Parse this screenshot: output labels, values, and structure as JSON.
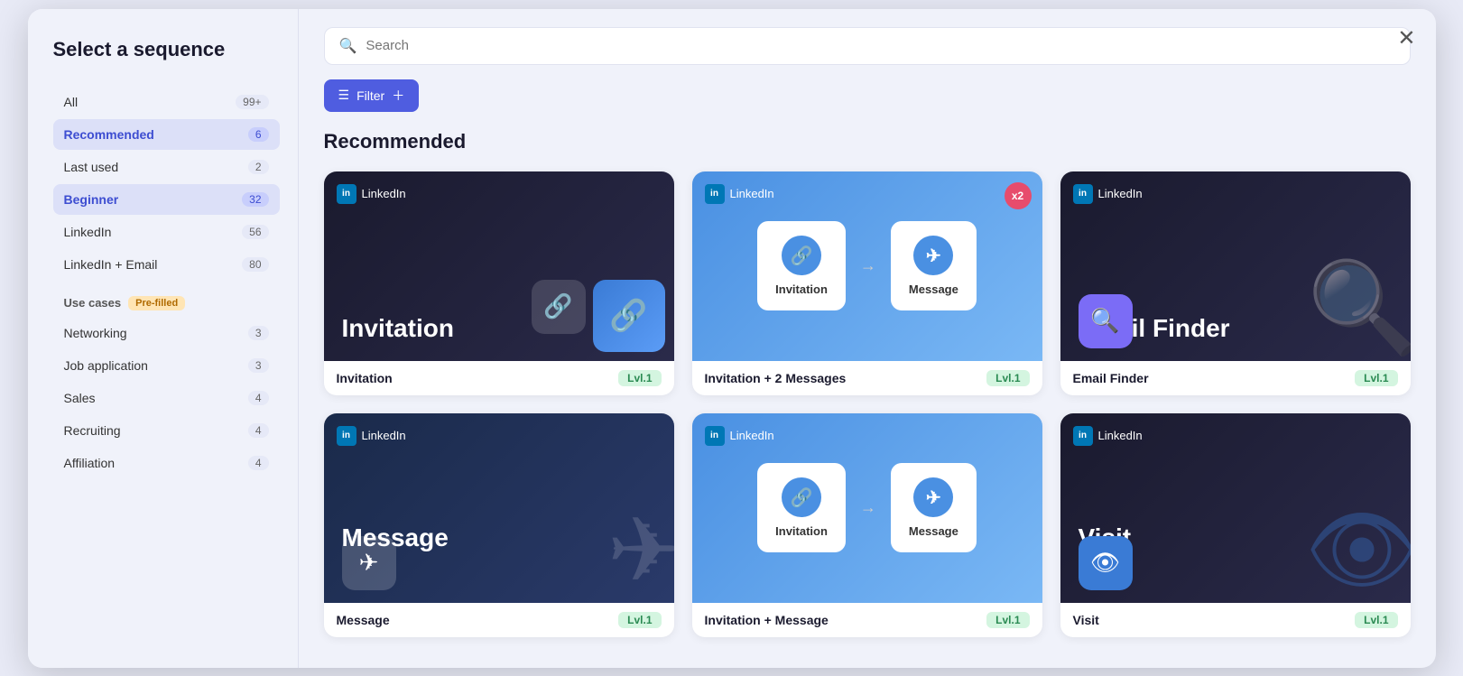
{
  "modal": {
    "title": "Select a sequence",
    "close_label": "✕"
  },
  "sidebar": {
    "title": "Select a sequence",
    "items": [
      {
        "id": "all",
        "label": "All",
        "count": "99+",
        "active": false
      },
      {
        "id": "recommended",
        "label": "Recommended",
        "count": "6",
        "active": true
      },
      {
        "id": "last-used",
        "label": "Last used",
        "count": "2",
        "active": false
      },
      {
        "id": "beginner",
        "label": "Beginner",
        "count": "32",
        "active": false
      },
      {
        "id": "linkedin",
        "label": "LinkedIn",
        "count": "56",
        "active": false
      },
      {
        "id": "linkedin-email",
        "label": "LinkedIn + Email",
        "count": "80",
        "active": false
      }
    ],
    "use_cases_label": "Use cases",
    "pre_filled_badge": "Pre-filled",
    "use_case_items": [
      {
        "id": "networking",
        "label": "Networking",
        "count": "3"
      },
      {
        "id": "job-application",
        "label": "Job application",
        "count": "3"
      },
      {
        "id": "sales",
        "label": "Sales",
        "count": "4"
      },
      {
        "id": "recruiting",
        "label": "Recruiting",
        "count": "4"
      },
      {
        "id": "affiliation",
        "label": "Affiliation",
        "count": "4"
      }
    ]
  },
  "search": {
    "placeholder": "Search"
  },
  "filter_button": {
    "label": "Filter",
    "icon": "filter-icon"
  },
  "section": {
    "heading": "Recommended"
  },
  "cards": [
    {
      "id": "invitation",
      "name": "Invitation",
      "level": "Lvl.1",
      "type": "single-dark",
      "platform": "LinkedIn",
      "main_title": "Invitation",
      "icon": "🔗"
    },
    {
      "id": "invitation-2-messages",
      "name": "Invitation + 2 Messages",
      "level": "Lvl.1",
      "type": "flow-blue",
      "platform": "LinkedIn",
      "steps": [
        "Invitation",
        "Message"
      ],
      "x2": "x2"
    },
    {
      "id": "email-finder",
      "name": "Email Finder",
      "level": "Lvl.1",
      "type": "single-dark",
      "platform": "LinkedIn",
      "main_title": "Email Finder",
      "icon": "🔍"
    },
    {
      "id": "message",
      "name": "Message",
      "level": "Lvl.1",
      "type": "single-blue",
      "platform": "LinkedIn",
      "main_title": "Message",
      "icon": "✉"
    },
    {
      "id": "invitation-message",
      "name": "Invitation + Message",
      "level": "Lvl.1",
      "type": "flow-blue",
      "platform": "LinkedIn",
      "steps": [
        "Invitation",
        "Message"
      ]
    },
    {
      "id": "visit",
      "name": "Visit",
      "level": "Lvl.1",
      "type": "single-dark-visit",
      "platform": "LinkedIn",
      "main_title": "Visit",
      "icon": "👁"
    }
  ]
}
